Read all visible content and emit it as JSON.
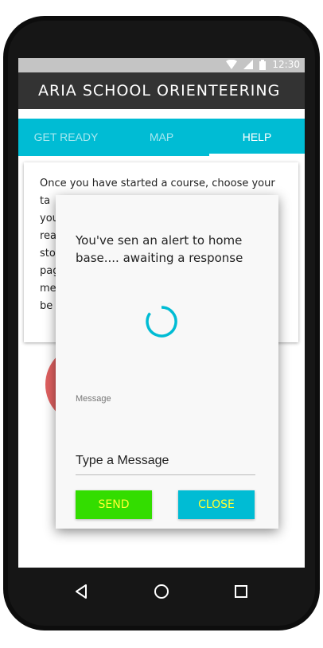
{
  "statusbar": {
    "time": "12:30"
  },
  "appbar": {
    "title": "ARIA SCHOOL ORIENTEERING"
  },
  "tabs": [
    {
      "label": "GET READY",
      "active": false
    },
    {
      "label": "MAP",
      "active": false
    },
    {
      "label": "HELP",
      "active": true
    }
  ],
  "card": {
    "lines": [
      "Once you have started a course, choose your",
      "ta",
      "you",
      "rea",
      "sto",
      "pag",
      "mes",
      "be"
    ]
  },
  "dialog": {
    "message": "You've sen an alert to home base.... awaiting a response",
    "field_label": "Message",
    "field_placeholder": "Type a Message",
    "send_label": "SEND",
    "close_label": "CLOSE"
  },
  "colors": {
    "accent": "#00bcd4",
    "appbar": "#333333",
    "send": "#33dd00",
    "button_text": "#ffff30",
    "red_circle": "#e06060"
  },
  "icons": {
    "wifi": "wifi-icon",
    "signal": "signal-icon",
    "battery": "battery-icon",
    "back": "back-icon",
    "home": "home-icon",
    "recents": "recents-icon",
    "spinner": "loading-spinner-icon"
  }
}
